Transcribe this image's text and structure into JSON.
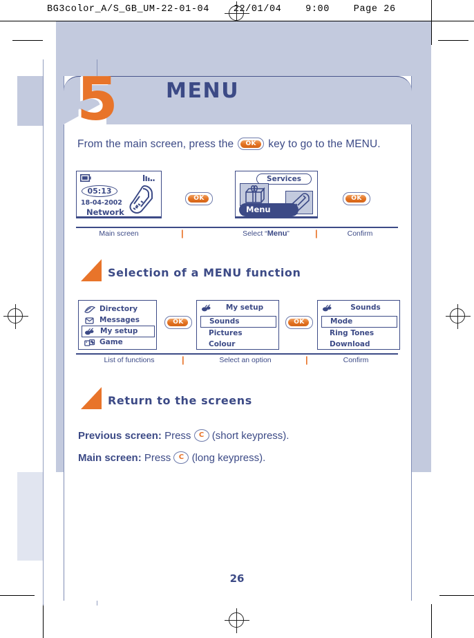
{
  "print": {
    "header_text": "BG3color_A/S_GB_UM-22-01-04    22/01/04    9:00    Page 26"
  },
  "chapter": {
    "number": "5",
    "title": "MENU"
  },
  "intro": {
    "before_key": "From the main screen, press the",
    "key_label": "OK",
    "after_key": "key to go to the MENU."
  },
  "flow_one": {
    "main_screen": {
      "time": "05:13",
      "date": "18-04-2002",
      "network": "Network",
      "battery_icon": "battery-icon",
      "signal_icon": "signal-bars-icon",
      "phone_icon": "mobile-phone-icon"
    },
    "menu_screen": {
      "services_label": "Services",
      "menu_label": "Menu",
      "tile_one_icon": "gift-services-icon",
      "tile_two_icon": "mobile-phone-icon"
    },
    "key_one_label": "OK",
    "key_two_label": "OK",
    "captions": {
      "left": "Main screen",
      "middle_prefix": "Select “",
      "middle_bold": "Menu",
      "middle_suffix": "”",
      "right": "Confirm",
      "separator": "|"
    }
  },
  "section_one": {
    "title": "Selection of a MENU function",
    "marker_icon": "orange-triangle-icon"
  },
  "flow_two": {
    "screen_one": {
      "items": [
        {
          "label": "Directory",
          "icon": "directory-icon",
          "selected": false
        },
        {
          "label": "Messages",
          "icon": "messages-icon",
          "selected": false
        },
        {
          "label": "My setup",
          "icon": "my-setup-icon",
          "selected": true
        },
        {
          "label": "Game",
          "icon": "game-icon",
          "selected": false
        }
      ]
    },
    "screen_two": {
      "header": "My setup",
      "header_icon": "my-setup-icon",
      "items": [
        {
          "label": "Sounds",
          "selected": true
        },
        {
          "label": "Pictures",
          "selected": false
        },
        {
          "label": "Colour",
          "selected": false
        }
      ]
    },
    "screen_three": {
      "header": "Sounds",
      "header_icon": "sounds-icon",
      "items": [
        {
          "label": "Mode",
          "selected": true
        },
        {
          "label": "Ring Tones",
          "selected": false
        },
        {
          "label": "Download",
          "selected": false
        }
      ]
    },
    "key_one_label": "OK",
    "key_two_label": "OK",
    "captions": {
      "left": "List of functions",
      "middle": "Select an option",
      "right": "Confirm",
      "separator": "|"
    }
  },
  "section_two": {
    "title": "Return to the screens",
    "marker_icon": "orange-triangle-icon"
  },
  "return_lines": [
    {
      "bold": "Previous screen:",
      "mid": "Press",
      "key_label": "C",
      "tail": "(short keypress)."
    },
    {
      "bold": "Main screen:",
      "mid": "Press",
      "key_label": "C",
      "tail": "(long keypress)."
    }
  ],
  "footer": {
    "page_number": "26"
  },
  "colors": {
    "brand_blue": "#3c4a86",
    "accent_orange": "#e8742a",
    "panel_blue": "#c3cade",
    "rule_blue": "#7f8cb4"
  }
}
